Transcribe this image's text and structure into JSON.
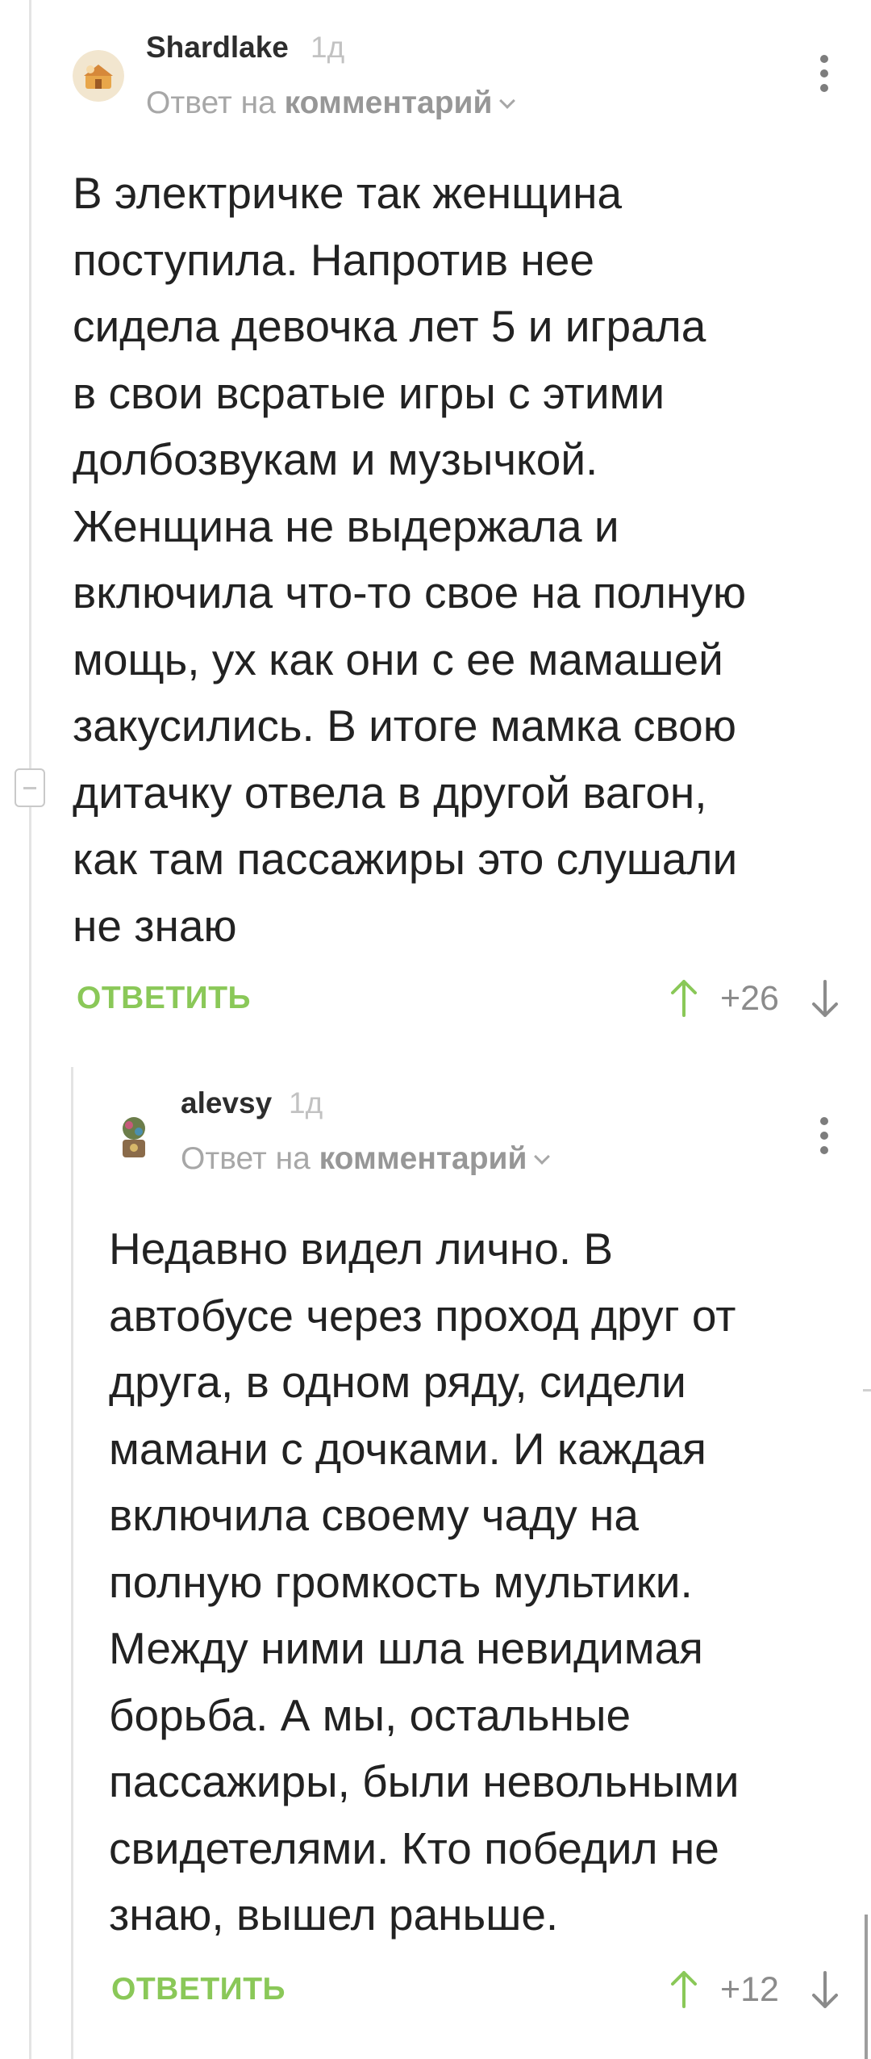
{
  "comments": [
    {
      "author": "Shardlake",
      "time": "1д",
      "reply_prefix": "Ответ на",
      "reply_target": "комментарий",
      "lines": [
        "В электричке так женщина",
        "поступила. Напротив нее",
        "сидела девочка лет 5 и играла",
        "в свои всратые игры с этими",
        "долбозвукам и музычкой.",
        "Женщина не выдержала и",
        "включила что-то свое на полную",
        "мощь, ух как они с ее мамашей",
        "закусились. В итоге мамка свою",
        "дитачку отвела в другой вагон,",
        "как там пассажиры это слушали",
        "не знаю"
      ],
      "reply_label": "ОТВЕТИТЬ",
      "rating": "+26"
    },
    {
      "author": "alevsy",
      "time": "1д",
      "reply_prefix": "Ответ на",
      "reply_target": "комментарий",
      "lines": [
        "Недавно видел лично. В",
        "автобусе через проход друг от",
        "друга, в одном ряду, сидели",
        "мамани с дочками. И каждая",
        "включила своему чаду на",
        "полную громкость мультики.",
        "Между ними шла невидимая",
        "борьба. А мы, остальные",
        "пассажиры, были невольными",
        "свидетелями. Кто победил не",
        "знаю, вышел раньше."
      ],
      "reply_label": "ОТВЕТИТЬ",
      "rating": "+12"
    }
  ],
  "colors": {
    "accent_green": "#8ac858",
    "text": "#222222",
    "muted": "#a7a7a7",
    "thread_line": "#e4e4e4"
  },
  "icons": [
    "avatar-shardlake",
    "avatar-alevsy",
    "more-options-icon",
    "upvote-icon",
    "downvote-icon",
    "collapse-thread-icon",
    "chevron-down-icon"
  ]
}
